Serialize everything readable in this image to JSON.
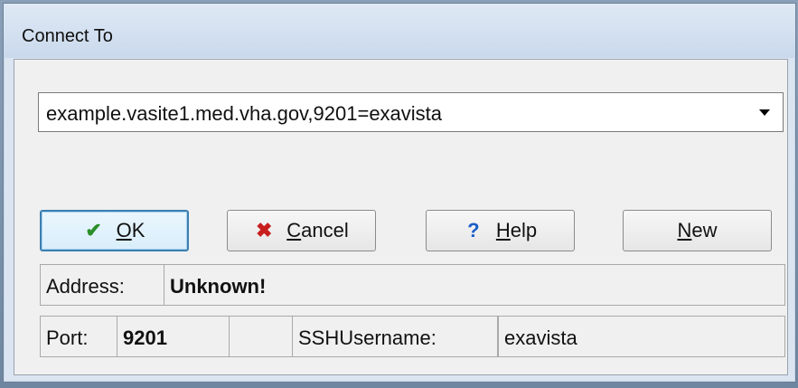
{
  "window": {
    "title": "Connect To"
  },
  "connection": {
    "selected": "example.vasite1.med.vha.gov,9201=exavista"
  },
  "buttons": {
    "ok": {
      "underlined": "O",
      "rest": "K"
    },
    "cancel": {
      "underlined": "C",
      "rest": "ancel"
    },
    "help": {
      "underlined": "H",
      "rest": "elp"
    },
    "new": {
      "underlined": "N",
      "rest": "ew"
    }
  },
  "address": {
    "label": "Address:",
    "value": "Unknown!"
  },
  "port": {
    "label": "Port:",
    "value": "9201"
  },
  "ssh": {
    "label": "SSHUsername:",
    "value": "exavista"
  },
  "colors": {
    "accent": "#3c7fb1",
    "ok_icon": "#2a8f2a",
    "cancel_icon": "#c81e1e",
    "help_icon": "#1a5ec8"
  }
}
